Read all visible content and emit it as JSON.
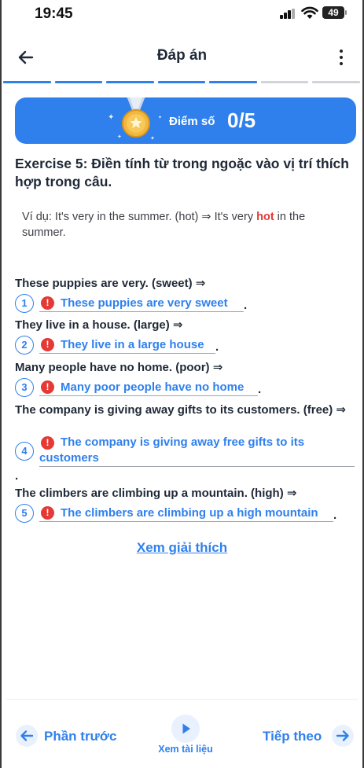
{
  "status_bar": {
    "time": "19:45",
    "battery": "49"
  },
  "header": {
    "title": "Đáp án"
  },
  "progress": {
    "total_segments": 7,
    "completed_segments": 5
  },
  "colors": {
    "accent": "#2f80ed",
    "error": "#e53935",
    "progress_done": "#2f80ed",
    "progress_pending": "#d1d5db"
  },
  "score": {
    "label": "Điểm số",
    "value": "0/5"
  },
  "exercise": {
    "title": "Exercise 5: Điền tính từ trong ngoặc vào vị trí thích hợp trong câu.",
    "example_prefix": "Ví dụ: It's very in the summer. (hot) ⇒ It's very ",
    "example_highlight": "hot",
    "example_suffix": " in the summer."
  },
  "questions": [
    {
      "number": "1",
      "prompt": "These puppies are very. (sweet) ⇒",
      "answer": "These puppies are very sweet",
      "period": ".",
      "status": "incorrect"
    },
    {
      "number": "2",
      "prompt": "They live in a house. (large) ⇒",
      "answer": "They live in a large house",
      "period": ".",
      "status": "incorrect"
    },
    {
      "number": "3",
      "prompt": "Many people have no home. (poor) ⇒",
      "answer": "Many poor people have no home",
      "period": ".",
      "status": "incorrect"
    },
    {
      "number": "4",
      "prompt": "The company is giving away gifts to its customers. (free) ⇒",
      "answer_line1": "The company is giving away free gifts to its",
      "answer_line2": "customers",
      "period": ".",
      "status": "incorrect"
    },
    {
      "number": "5",
      "prompt": "The climbers are climbing up a mountain. (high) ⇒",
      "answer": "The climbers are climbing up a high mountain",
      "period": ".",
      "status": "incorrect"
    }
  ],
  "explain_link": "Xem giải thích",
  "bottom_nav": {
    "prev_label": "Phần trước",
    "play_label": "Xem tài liệu",
    "next_label": "Tiếp theo"
  }
}
